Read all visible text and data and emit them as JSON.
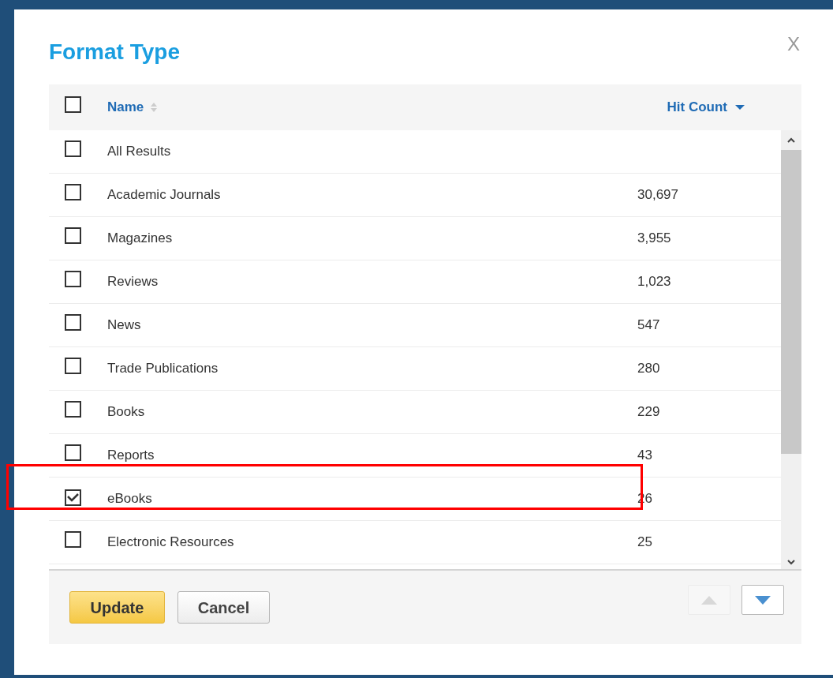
{
  "dialog": {
    "title": "Format Type",
    "close": "X"
  },
  "table": {
    "header": {
      "checked": false,
      "columns": [
        {
          "label": "Name",
          "kind": "sortable"
        },
        {
          "label": "Hit Count",
          "kind": "sorted"
        }
      ]
    },
    "rows": [
      {
        "name": "All Results",
        "checked": false
      },
      {
        "name": "Academic Journals",
        "count": "30,697",
        "checked": false
      },
      {
        "name": "Magazines",
        "count": "3,955",
        "checked": false
      },
      {
        "name": "Reviews",
        "count": "1,023",
        "checked": false
      },
      {
        "name": "News",
        "count": "547",
        "checked": false
      },
      {
        "name": "Trade Publications",
        "count": "280",
        "checked": false
      },
      {
        "name": "Books",
        "count": "229",
        "checked": false
      },
      {
        "name": "Reports",
        "count": "43",
        "checked": false
      },
      {
        "name": "eBooks",
        "count": "26",
        "checked": true
      },
      {
        "name": "Electronic Resources",
        "count": "25",
        "checked": false
      }
    ]
  },
  "footer": {
    "buttons": [
      {
        "label": "Update",
        "kind": "primary"
      },
      {
        "label": "Cancel",
        "kind": "secondary"
      }
    ],
    "pager": [
      {
        "kind": "up",
        "disabled": true
      },
      {
        "kind": "down",
        "disabled": false
      }
    ]
  }
}
